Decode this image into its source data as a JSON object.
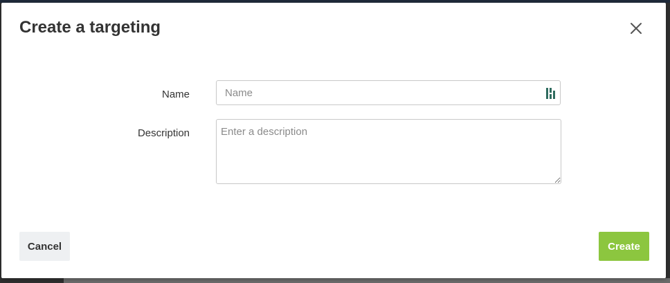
{
  "dialog": {
    "title": "Create a targeting",
    "close_icon": "close-icon"
  },
  "form": {
    "name": {
      "label": "Name",
      "value": "",
      "placeholder": "Name",
      "addon_icon": "password-manager-icon"
    },
    "description": {
      "label": "Description",
      "value": "",
      "placeholder": "Enter a description"
    }
  },
  "footer": {
    "cancel_label": "Cancel",
    "create_label": "Create"
  },
  "colors": {
    "primary": "#8cc63f",
    "secondary_bg": "#eef0f2",
    "text": "#333333",
    "addon_icon": "#2e6b5e"
  }
}
